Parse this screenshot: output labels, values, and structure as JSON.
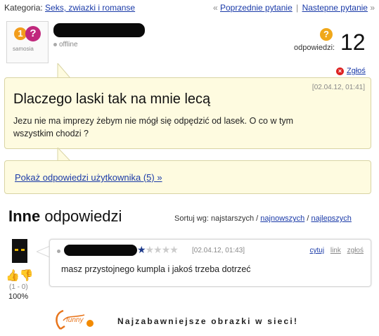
{
  "topbar": {
    "category_label": "Kategoria:",
    "category_link": "Seks, zwiazki i romanse",
    "prev_prefix": "«",
    "prev_link": "Poprzednie pytanie",
    "separator": "|",
    "next_link": "Nastepne pytanie",
    "next_suffix": "»"
  },
  "user": {
    "avatar_logo": "samosia",
    "status": "offline"
  },
  "answers_summary": {
    "icon_glyph": "?",
    "label": "odpowiedzi:",
    "count": "12"
  },
  "report": {
    "label": "Zgłoś"
  },
  "question": {
    "date": "[02.04.12, 01:41]",
    "title": "Dlaczego laski tak na mnie lecą",
    "body": "Jezu nie ma imprezy żebym nie mógł się odpędzić od lasek. O co w tym wszystkim chodzi ?"
  },
  "profile_link": {
    "label": "Pokaż odpowiedzi użytkownika (5) »"
  },
  "other_answers": {
    "heading_bold": "Inne",
    "heading_rest": " odpowiedzi",
    "sort_label": "Sortuj wg: najstarszych /",
    "sort_newest": "najnowszych",
    "sort_sep": "/",
    "sort_best": "najlepszych"
  },
  "answer": {
    "rating": {
      "stars_filled": 1,
      "stars_total": 5
    },
    "date": "[02.04.12, 01:43]",
    "actions": {
      "quote": "cytuj",
      "link": "link",
      "report": "zgłoś"
    },
    "text": "masz przystojnego kumpla i jakoś trzeba dotrzeć",
    "votes": "(1 - 0)",
    "percent": "100%"
  },
  "footer": {
    "logo": "funny",
    "tagline": "Najzabawniejsze obrazki w sieci!"
  }
}
